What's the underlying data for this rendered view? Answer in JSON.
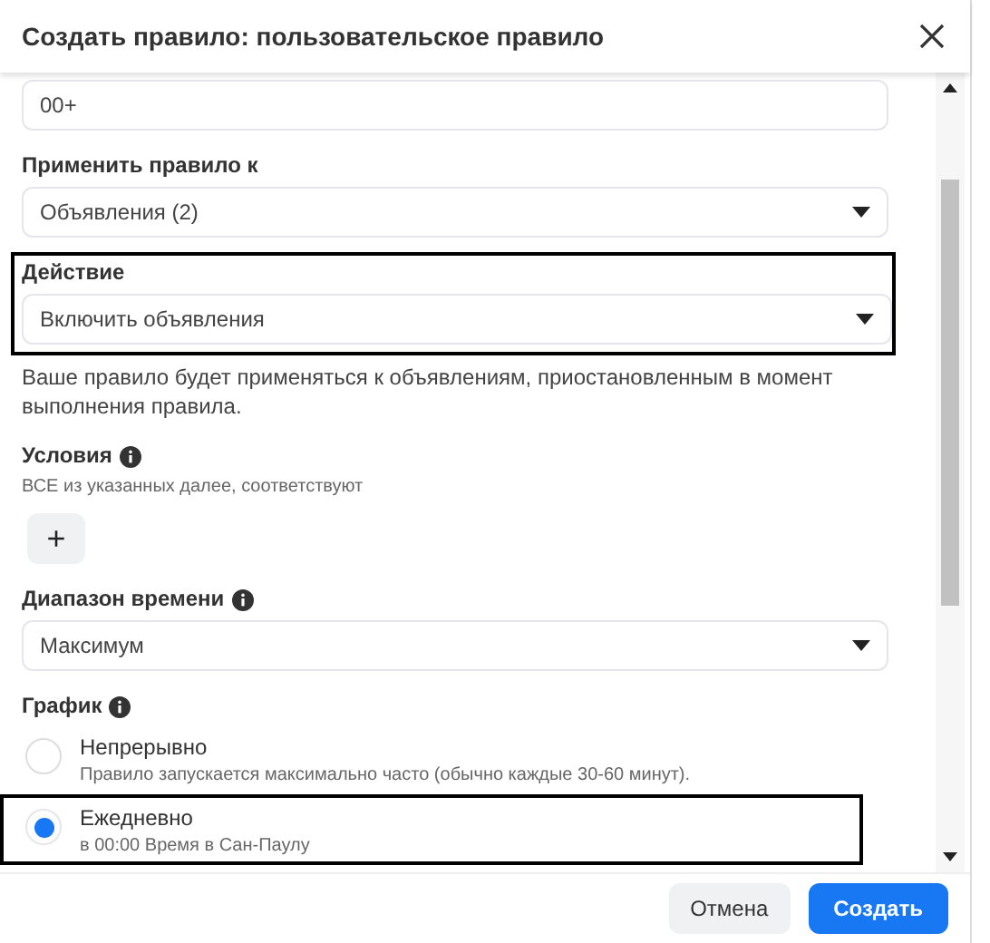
{
  "dialog": {
    "title": "Создать правило: пользовательское правило"
  },
  "fields": [
    {
      "kind": "text",
      "value": "00+"
    },
    {
      "kind": "select",
      "label": "Применить правило к",
      "value": "Объявления (2)",
      "highlighted": false
    },
    {
      "kind": "select",
      "label": "Действие",
      "value": "Включить объявления",
      "highlighted": true,
      "note": "Ваше правило будет применяться к объявлениям, приостановленным в момент выполнения правила."
    },
    {
      "kind": "conditions",
      "label": "Условия",
      "info": true,
      "hint": "ВСЕ из указанных далее, соответствуют",
      "button": "+"
    },
    {
      "kind": "select",
      "label": "Диапазон времени",
      "info": true,
      "value": "Максимум",
      "highlighted": false
    },
    {
      "kind": "radio",
      "label": "График",
      "info": true,
      "options": [
        {
          "label": "Непрерывно",
          "sub": "Правило запускается максимально часто (обычно каждые 30-60 минут).",
          "selected": false,
          "highlighted": false
        },
        {
          "label": "Ежедневно",
          "sub": "в 00:00 Время в Сан-Паулу",
          "selected": true,
          "highlighted": true
        }
      ]
    }
  ],
  "buttons": [
    {
      "label": "Отмена",
      "kind": "secondary"
    },
    {
      "label": "Создать",
      "kind": "primary"
    }
  ]
}
